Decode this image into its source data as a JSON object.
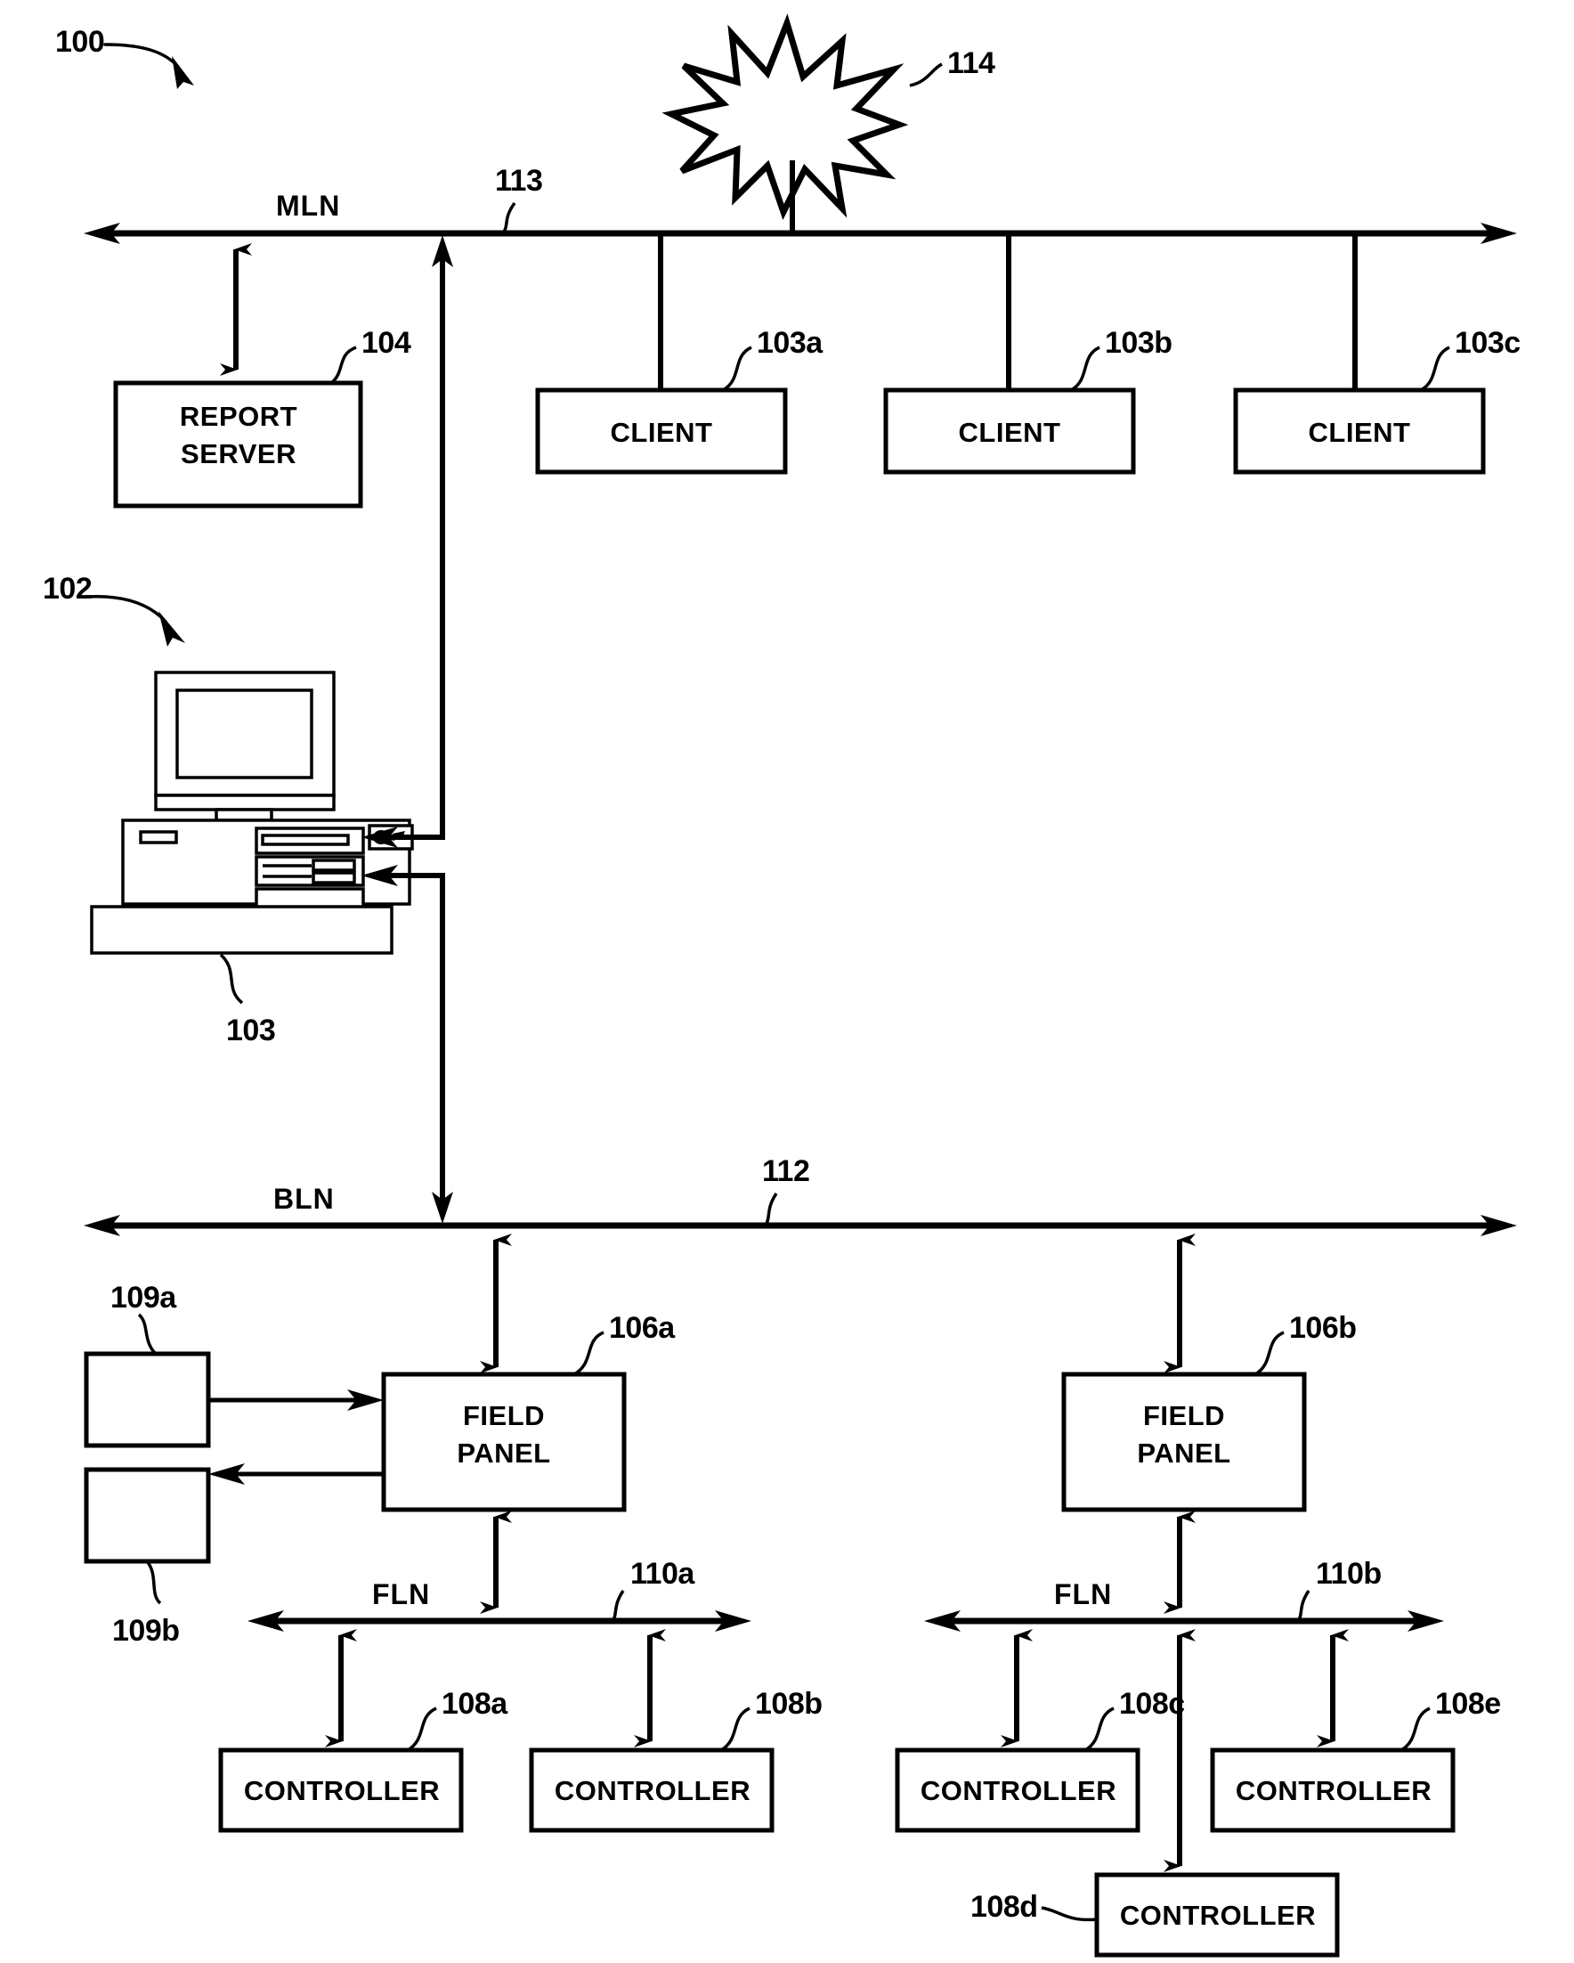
{
  "figure": {
    "system_ref": "100",
    "workstation_ref": "102",
    "workstation_sub_ref": "103"
  },
  "buses": [
    {
      "id": "mln",
      "name": "MLN",
      "ref": "113"
    },
    {
      "id": "bln",
      "name": "BLN",
      "ref": "112"
    },
    {
      "id": "fln_left",
      "name": "FLN",
      "ref": "110a"
    },
    {
      "id": "fln_right",
      "name": "FLN",
      "ref": "110b"
    }
  ],
  "burst": {
    "ref": "114"
  },
  "nodes": [
    {
      "id": "report_server",
      "label_line1": "REPORT",
      "label_line2": "SERVER",
      "ref": "104"
    },
    {
      "id": "client_a",
      "label": "CLIENT",
      "ref": "103a"
    },
    {
      "id": "client_b",
      "label": "CLIENT",
      "ref": "103b"
    },
    {
      "id": "client_c",
      "label": "CLIENT",
      "ref": "103c"
    },
    {
      "id": "field_panel_a",
      "label_line1": "FIELD",
      "label_line2": "PANEL",
      "ref": "106a"
    },
    {
      "id": "field_panel_b",
      "label_line1": "FIELD",
      "label_line2": "PANEL",
      "ref": "106b"
    },
    {
      "id": "device_a",
      "label": "",
      "ref": "109a"
    },
    {
      "id": "device_b",
      "label": "",
      "ref": "109b"
    },
    {
      "id": "controller_a",
      "label": "CONTROLLER",
      "ref": "108a"
    },
    {
      "id": "controller_b",
      "label": "CONTROLLER",
      "ref": "108b"
    },
    {
      "id": "controller_c",
      "label": "CONTROLLER",
      "ref": "108c"
    },
    {
      "id": "controller_d",
      "label": "CONTROLLER",
      "ref": "108d"
    },
    {
      "id": "controller_e",
      "label": "CONTROLLER",
      "ref": "108e"
    }
  ],
  "colors": {
    "ink": "#000000",
    "paper": "#ffffff"
  }
}
